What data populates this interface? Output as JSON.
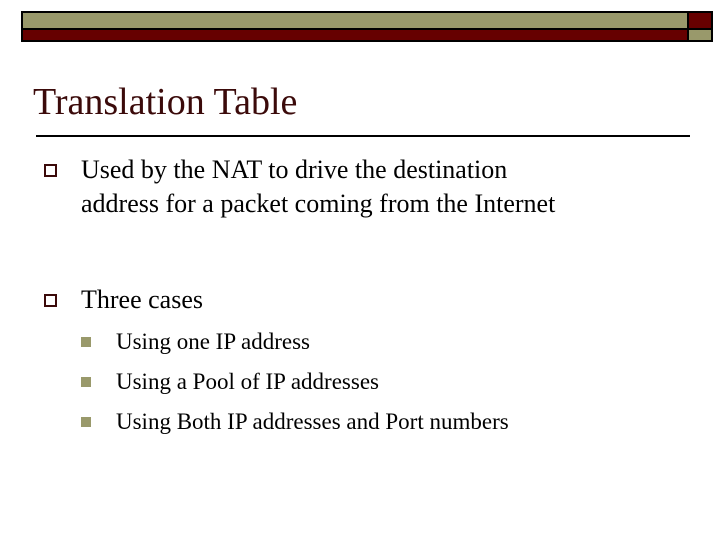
{
  "colors": {
    "accent_olive": "#99996b",
    "accent_dark_red": "#660000",
    "title": "#3b0a0a",
    "text": "#000000"
  },
  "slide": {
    "title": "Translation Table",
    "bullets": [
      {
        "icon": "hollow-square-bullet",
        "lines": [
          "Used by the NAT to drive the destination",
          "address for a packet coming from the Internet"
        ]
      },
      {
        "icon": "hollow-square-bullet",
        "text": "Three cases",
        "sub_bullets": [
          {
            "icon": "filled-square-bullet",
            "text": "Using one IP address"
          },
          {
            "icon": "filled-square-bullet",
            "text": "Using a Pool of IP addresses"
          },
          {
            "icon": "filled-square-bullet",
            "text": "Using Both IP addresses and Port numbers"
          }
        ]
      }
    ]
  }
}
